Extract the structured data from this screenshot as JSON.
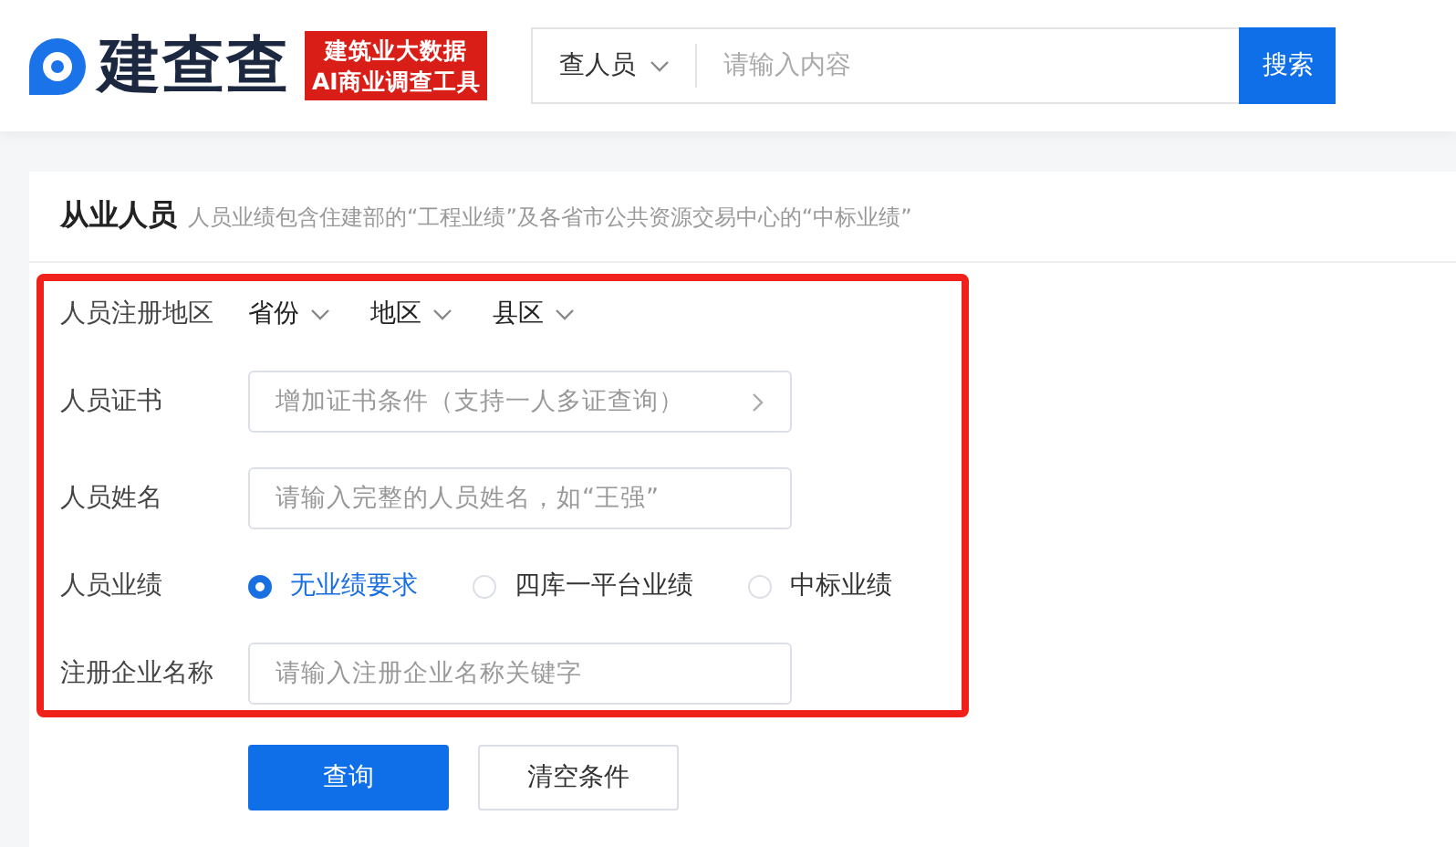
{
  "header": {
    "logo_text": "建查查",
    "badge_lines": [
      "建筑业大数据",
      "AI商业调查工具"
    ],
    "search": {
      "scope": "查人员",
      "placeholder": "请输入内容",
      "button": "搜索"
    }
  },
  "panel": {
    "title": "从业人员",
    "subtitle": "人员业绩包含住建部的“工程业绩”及各省市公共资源交易中心的“中标业绩”",
    "form": [
      {
        "kind": "selects",
        "label": "人员注册地区",
        "options": [
          "省份",
          "地区",
          "县区"
        ]
      },
      {
        "kind": "picker",
        "label": "人员证书",
        "placeholder": "增加证书条件（支持一人多证查询）"
      },
      {
        "kind": "input",
        "label": "人员姓名",
        "placeholder": "请输入完整的人员姓名，如“王强”"
      },
      {
        "kind": "radios",
        "label": "人员业绩",
        "options": [
          {
            "label": "无业绩要求",
            "selected": true
          },
          {
            "label": "四库一平台业绩",
            "selected": false
          },
          {
            "label": "中标业绩",
            "selected": false
          }
        ]
      },
      {
        "kind": "input",
        "label": "注册企业名称",
        "placeholder": "请输入注册企业名称关键字"
      }
    ],
    "buttons": [
      {
        "label": "查询",
        "kind": "primary"
      },
      {
        "label": "清空条件",
        "kind": "default"
      }
    ]
  }
}
